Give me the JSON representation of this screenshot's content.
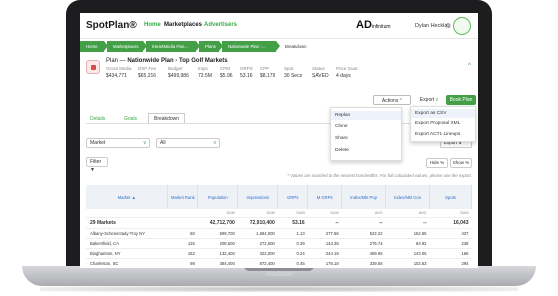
{
  "app": {
    "logo": "SpotPlan®",
    "nav": [
      "Home",
      "Marketplaces",
      "Advertisers"
    ],
    "active_nav": "Marketplaces"
  },
  "brand_logo": {
    "main": "AD",
    "sub": "infinitum"
  },
  "user": {
    "name": "Dylan Hecklau"
  },
  "breadcrumb": [
    "Home",
    "Marketplaces",
    "iHeartMedia Five...",
    "Plans",
    "Nationwide Plan -...",
    "Breakdown"
  ],
  "plan": {
    "title_prefix": "Plan — ",
    "title": "Nationwide Plan - Top Golf Markets",
    "metrics": [
      {
        "label": "Gross Media",
        "value": "$434,771"
      },
      {
        "label": "DSP Fee",
        "value": "$65,216"
      },
      {
        "label": "Budget",
        "value": "$499,986"
      },
      {
        "label": "Imps",
        "value": "72.5M"
      },
      {
        "label": "CPM",
        "value": "$5.96"
      },
      {
        "label": "GRPS",
        "value": "53.16"
      },
      {
        "label": "CPP",
        "value": "$8,179"
      },
      {
        "label": "Spot",
        "value": "30 Secs"
      },
      {
        "label": "Status",
        "value": "SAVED"
      },
      {
        "label": "Price Guar.",
        "value": "4 days"
      }
    ]
  },
  "toolbar": {
    "actions_label": "Actions",
    "export_label": "Export",
    "book_label": "Book Plan"
  },
  "actions_menu": [
    "Replan",
    "Clone",
    "Share",
    "Delete"
  ],
  "export_menu": [
    "Export as CSV",
    "Export Proposal XML",
    "Export ACT1 Lineups"
  ],
  "tabs": [
    "Details",
    "Goals",
    "Breakdown"
  ],
  "active_tab": "Breakdown",
  "filters": {
    "group_by": "Market",
    "scope": "All",
    "filter_label": "Filter",
    "export_label": "Export"
  },
  "hide_pct_label": "Hide %",
  "show_pct_label": "Show %",
  "note": "* Values are rounded to the nearest hundredths. For full calculated values, please use the export.",
  "table": {
    "headers": [
      "Market ▲",
      "Market Rank",
      "Population",
      "Impressions",
      "GRPs",
      "M GRPs",
      "Index/Mkt Pop",
      "Index/Mkt Con",
      "Spots"
    ],
    "subheaders": [
      "",
      "",
      "SUM",
      "SUM",
      "SUM",
      "SUM",
      "AVG",
      "AVG",
      "SUM"
    ],
    "total": [
      "29 Markets",
      "",
      "42,712,700",
      "72,910,400",
      "53.16",
      "--",
      "--",
      "--",
      "16,043"
    ],
    "rows": [
      [
        "Albany-Schenectady-Troy NY",
        "60",
        "599,700",
        "1,694,000",
        "1.13",
        "277.66",
        "522.22",
        "152.65",
        "437"
      ],
      [
        "Bakersfield, CA",
        "126",
        "208,600",
        "272,600",
        "0.39",
        "144.38",
        "275.74",
        "84.92",
        "238"
      ],
      [
        "Binghamton, NY",
        "162",
        "132,400",
        "322,000",
        "0.24",
        "244.18",
        "469.95",
        "143.05",
        "166"
      ],
      [
        "Charleston, SC",
        "98",
        "384,400",
        "872,400",
        "0.45",
        "176.18",
        "339.56",
        "102.63",
        "294"
      ]
    ]
  }
}
